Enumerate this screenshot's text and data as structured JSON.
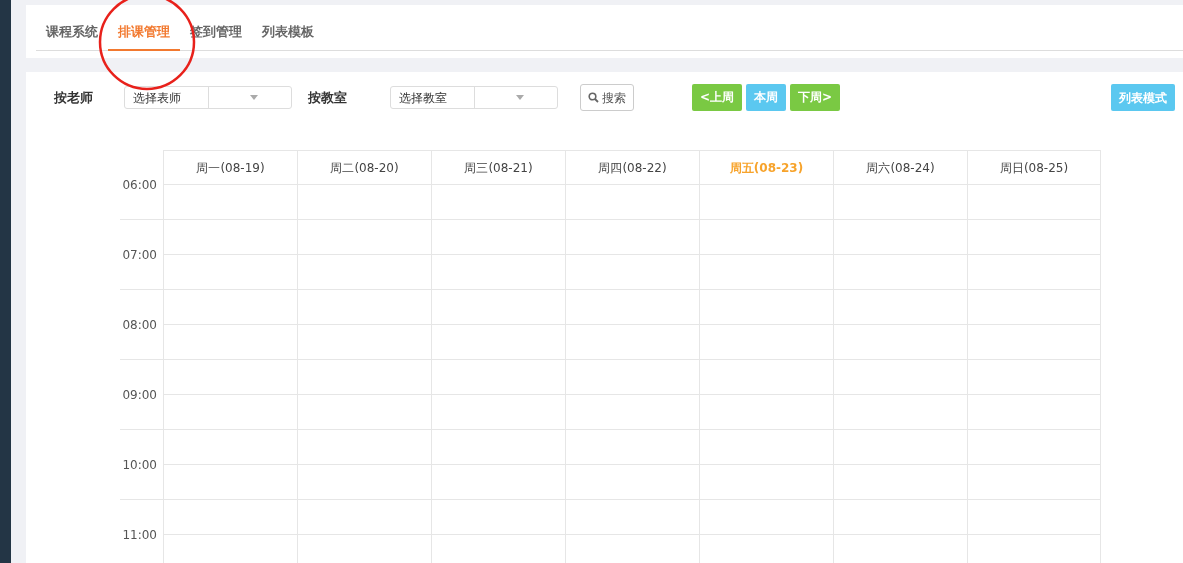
{
  "tabs": [
    {
      "label": "课程系统",
      "selected": false
    },
    {
      "label": "排课管理",
      "selected": true
    },
    {
      "label": "签到管理",
      "selected": false
    },
    {
      "label": "列表模板",
      "selected": false
    }
  ],
  "filters": [
    {
      "label": "按老师",
      "placeholder": "选择表师"
    },
    {
      "label": "按教室",
      "placeholder": "选择教室"
    }
  ],
  "search_button": "搜索",
  "week_buttons": [
    {
      "label": "<上周",
      "kind": "nav"
    },
    {
      "label": "本周",
      "kind": "current"
    },
    {
      "label": "下周>",
      "kind": "nav"
    }
  ],
  "list_mode_button": "列表模式",
  "days": [
    {
      "label": "周一(08-19)",
      "today": false
    },
    {
      "label": "周二(08-20)",
      "today": false
    },
    {
      "label": "周三(08-21)",
      "today": false
    },
    {
      "label": "周四(08-22)",
      "today": false
    },
    {
      "label": "周五(08-23)",
      "today": true
    },
    {
      "label": "周六(08-24)",
      "today": false
    },
    {
      "label": "周日(08-25)",
      "today": false
    }
  ],
  "times": [
    "06:00",
    "07:00",
    "08:00",
    "09:00",
    "10:00",
    "11:00"
  ],
  "annotation": {
    "kind": "circle",
    "color": "#e8211b"
  }
}
